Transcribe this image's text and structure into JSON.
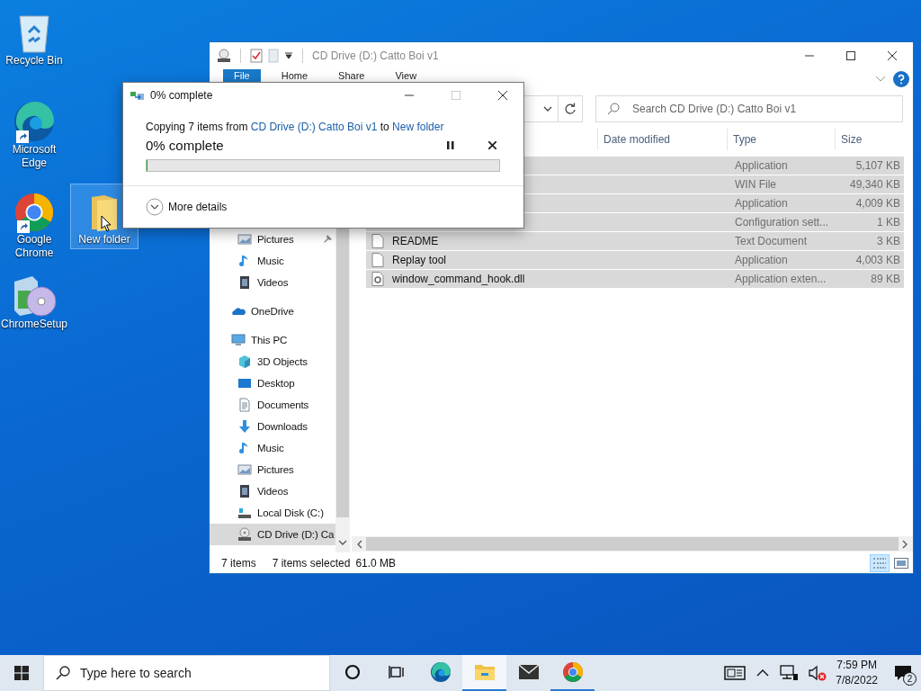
{
  "desktop_icons": [
    {
      "kind": "recycle-bin",
      "label": "Recycle Bin",
      "shortcut": false,
      "selected": false
    },
    {
      "kind": "edge",
      "label": "Microsoft Edge",
      "shortcut": true,
      "selected": false
    },
    {
      "kind": "chrome",
      "label": "Google Chrome",
      "shortcut": true,
      "selected": false
    },
    {
      "kind": "setup",
      "label": "ChromeSetup",
      "shortcut": false,
      "selected": false
    },
    {
      "kind": "folder",
      "label": "New folder",
      "shortcut": false,
      "selected": true
    }
  ],
  "explorer": {
    "title": "CD Drive (D:) Catto Boi v1",
    "ribbon_tabs": [
      {
        "label": "File",
        "kind": "file-menu"
      },
      {
        "label": "Home",
        "kind": "tab"
      },
      {
        "label": "Share",
        "kind": "tab"
      },
      {
        "label": "View",
        "kind": "tab"
      }
    ],
    "search": {
      "placeholder": "Search CD Drive (D:) Catto Boi v1"
    },
    "columns": [
      "Date modified",
      "Type",
      "Size"
    ],
    "rows": [
      {
        "type": "Application",
        "size": "5,107 KB",
        "selected": true
      },
      {
        "type": "WIN File",
        "size": "49,340 KB",
        "selected": true
      },
      {
        "type": "Application",
        "size": "4,009 KB",
        "selected": true
      },
      {
        "type": "Configuration sett...",
        "size": "1 KB",
        "selected": true
      },
      {
        "name": "README",
        "kind": "file",
        "type": "Text Document",
        "size": "3 KB",
        "selected": true
      },
      {
        "name": "Replay tool",
        "kind": "file",
        "type": "Application",
        "size": "4,003 KB",
        "selected": true
      },
      {
        "name": "window_command_hook.dll",
        "kind": "dll",
        "type": "Application exten...",
        "size": "89 KB",
        "selected": true
      }
    ],
    "nav": [
      {
        "children": [
          {
            "label": "Pictures",
            "kind": "pictures",
            "pinned": true,
            "selected": false
          },
          {
            "label": "Music",
            "kind": "music",
            "pinned": false,
            "selected": false
          },
          {
            "label": "Videos",
            "kind": "videos",
            "pinned": false,
            "selected": false
          }
        ]
      },
      {
        "label": "OneDrive",
        "kind": "onedrive",
        "selected": false
      },
      {
        "label": "This PC",
        "kind": "pc",
        "selected": false,
        "children": [
          {
            "label": "3D Objects",
            "kind": "objects",
            "selected": false
          },
          {
            "label": "Desktop",
            "kind": "desktop",
            "selected": false
          },
          {
            "label": "Documents",
            "kind": "documents",
            "selected": false
          },
          {
            "label": "Downloads",
            "kind": "downloads",
            "selected": false
          },
          {
            "label": "Music",
            "kind": "music",
            "selected": false
          },
          {
            "label": "Pictures",
            "kind": "pictures",
            "selected": false
          },
          {
            "label": "Videos",
            "kind": "videos",
            "selected": false
          },
          {
            "label": "Local Disk (C:)",
            "kind": "disk",
            "selected": false
          },
          {
            "label": "CD Drive (D:) Ca",
            "kind": "cd",
            "selected": true
          }
        ]
      }
    ],
    "status": {
      "count": "7 items",
      "selection": "7 items selected",
      "size": "61.0 MB"
    },
    "view_buttons": [
      {
        "kind": "details",
        "selected": true
      },
      {
        "kind": "large-icons",
        "selected": false
      }
    ]
  },
  "copy_dialog": {
    "title": "0% complete",
    "message": {
      "prefix": "Copying 7 items from",
      "source": "CD Drive (D:) Catto Boi v1",
      "joiner": "to",
      "destination": "New folder"
    },
    "status": "0% complete",
    "level": 0,
    "maximize_disabled": true,
    "more_details": "More details"
  },
  "taskbar": {
    "search": {
      "placeholder": "Type here to search"
    },
    "apps": [
      {
        "kind": "cortana",
        "running": false,
        "selected": false
      },
      {
        "kind": "task-view",
        "running": false,
        "selected": false
      },
      {
        "kind": "edge",
        "running": false,
        "selected": false
      },
      {
        "kind": "explorer",
        "running": true,
        "selected": true
      },
      {
        "kind": "mail",
        "running": false,
        "selected": false
      },
      {
        "kind": "chrome",
        "running": true,
        "selected": false
      }
    ],
    "tray": {
      "volume_muted": true,
      "time": "7:59 PM",
      "date": "7/8/2022",
      "notifications": "2"
    }
  }
}
